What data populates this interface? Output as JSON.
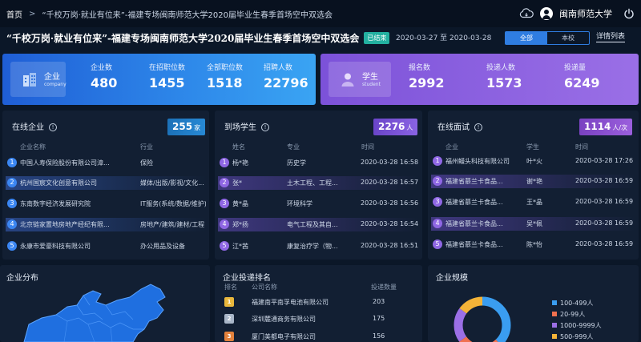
{
  "topbar": {
    "home": "首页",
    "breadcrumb_sep": ">",
    "breadcrumb": "“千校万岗·就业有位来”-福建专场闽南师范大学2020届毕业生春季首场空中双选会",
    "user_name": "闽南师范大学"
  },
  "header": {
    "title": "“千校万岗·就业有位来”-福建专场闽南师范大学2020届毕业生春季首场空中双选会",
    "status_badge": "已结束",
    "date_range": "2020-03-27 至 2020-03-28",
    "filter_all": "全部",
    "filter_school": "本校",
    "detail_link": "详情列表"
  },
  "company_banner": {
    "label": "企业",
    "sub": "company",
    "stats": [
      {
        "key": "企业数",
        "value": "480"
      },
      {
        "key": "在招职位数",
        "value": "1455"
      },
      {
        "key": "全部职位数",
        "value": "1518"
      },
      {
        "key": "招聘人数",
        "value": "22796"
      }
    ]
  },
  "student_banner": {
    "label": "学生",
    "sub": "student",
    "stats": [
      {
        "key": "报名数",
        "value": "2992"
      },
      {
        "key": "投递人数",
        "value": "1573"
      },
      {
        "key": "投递量",
        "value": "6249"
      }
    ]
  },
  "online_companies": {
    "title": "在线企业",
    "count": "255",
    "unit": "家",
    "col_name": "企业名称",
    "col_industry": "行业",
    "rows": [
      {
        "rank": "1",
        "name": "中国人寿保险股份有限公司漳...",
        "industry": "保险"
      },
      {
        "rank": "2",
        "name": "杭州国宸文化创意有限公司",
        "industry": "媒体/出版/影视/文化..."
      },
      {
        "rank": "3",
        "name": "东南数字经济发展研究院",
        "industry": "IT服务(系统/数据/维护)"
      },
      {
        "rank": "4",
        "name": "北京链家置地房地产经纪有限...",
        "industry": "房地产/建筑/建材/工程"
      },
      {
        "rank": "5",
        "name": "永康市爱豪科技有限公司",
        "industry": "办公用品及设备"
      }
    ]
  },
  "onsite_students": {
    "title": "到场学生",
    "count": "2276",
    "unit": "人",
    "col_name": "姓名",
    "col_major": "专业",
    "col_time": "时间",
    "rows": [
      {
        "rank": "1",
        "name": "杨*艳",
        "major": "历史学",
        "time": "2020-03-28 16:58"
      },
      {
        "rank": "2",
        "name": "张*",
        "major": "土木工程、工程...",
        "time": "2020-03-28 16:57"
      },
      {
        "rank": "3",
        "name": "黄*晶",
        "major": "环境科学",
        "time": "2020-03-28 16:56"
      },
      {
        "rank": "4",
        "name": "郑*扬",
        "major": "电气工程及其自...",
        "time": "2020-03-28 16:54"
      },
      {
        "rank": "5",
        "name": "江*茜",
        "major": "康复治疗学（物...",
        "time": "2020-03-28 16:51"
      }
    ]
  },
  "online_interviews": {
    "title": "在线面试",
    "count": "1114",
    "unit": "人/次",
    "col_company": "企业",
    "col_student": "学生",
    "col_time": "时间",
    "rows": [
      {
        "rank": "1",
        "company": "福州鳗头科技有限公司",
        "student": "叶*火",
        "time": "2020-03-28 17:26"
      },
      {
        "rank": "2",
        "company": "福建省慕兰卡食品...",
        "student": "谢*艳",
        "time": "2020-03-28 16:59"
      },
      {
        "rank": "3",
        "company": "福建省慕兰卡食品...",
        "student": "王*晶",
        "time": "2020-03-28 16:59"
      },
      {
        "rank": "4",
        "company": "福建省慕兰卡食品...",
        "student": "吴*佩",
        "time": "2020-03-28 16:59"
      },
      {
        "rank": "5",
        "company": "福建省慕兰卡食品...",
        "student": "陈*怡",
        "time": "2020-03-28 16:59"
      }
    ]
  },
  "distribution": {
    "title": "企业分布"
  },
  "ranking": {
    "title": "企业投递排名",
    "col_rank": "排名",
    "col_company": "公司名称",
    "col_count": "投递数量",
    "rows": [
      {
        "rank": "1",
        "company": "福建南平南孚电池有限公司",
        "count": "203"
      },
      {
        "rank": "2",
        "company": "深圳麓通商务有限公司",
        "count": "175"
      },
      {
        "rank": "3",
        "company": "厦门美都电子有限公司",
        "count": "156"
      }
    ]
  },
  "scale": {
    "title": "企业规模",
    "chart_data": {
      "type": "pie",
      "categories": [
        "100-499人",
        "20-99人",
        "1000-9999人",
        "500-999人"
      ],
      "values": [
        38,
        27,
        20,
        15
      ],
      "colors": [
        "#3a9df0",
        "#f0704f",
        "#9b6fe6",
        "#f3b338"
      ]
    }
  },
  "colors": {
    "accent_blue": "#2f7de1",
    "badge_green": "#23b0a0",
    "purple": "#8f67e4"
  }
}
